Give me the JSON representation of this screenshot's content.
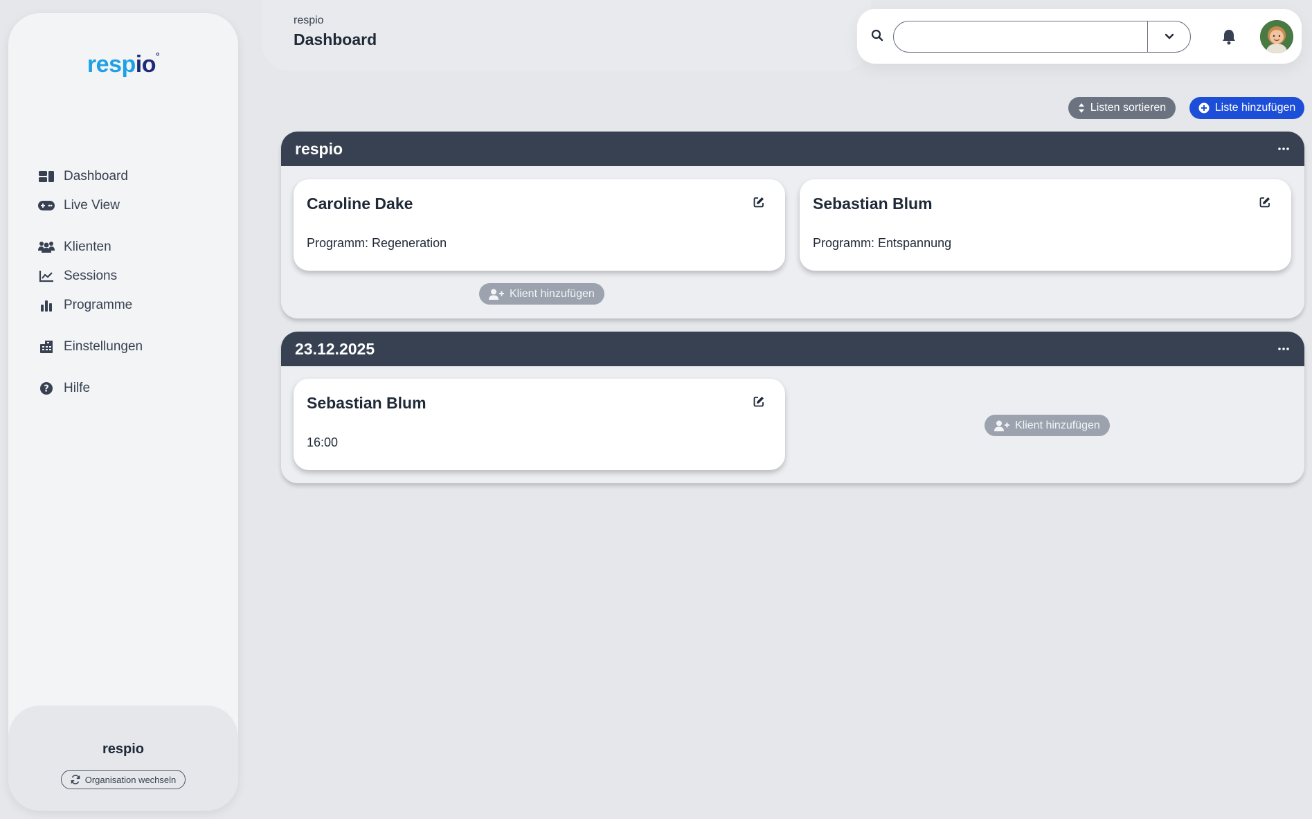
{
  "sidebar": {
    "logo_text_a": "resp",
    "logo_text_b": "io",
    "logo_mark": "°",
    "nav": [
      {
        "label": "Dashboard",
        "icon": "dashboard-icon"
      },
      {
        "label": "Live View",
        "icon": "gamepad-icon"
      },
      {
        "label": "Klienten",
        "icon": "users-icon"
      },
      {
        "label": "Sessions",
        "icon": "chart-line-icon"
      },
      {
        "label": "Programme",
        "icon": "chart-bar-icon"
      },
      {
        "label": "Einstellungen",
        "icon": "building-icon"
      },
      {
        "label": "Hilfe",
        "icon": "question-circle-icon"
      }
    ],
    "org_name": "respio",
    "org_switch_label": "Organisation wechseln"
  },
  "header": {
    "breadcrumb": "respio",
    "title": "Dashboard"
  },
  "topbar": {
    "search_value": "",
    "search_placeholder": ""
  },
  "actions": {
    "sort_label": "Listen sortieren",
    "add_list_label": "Liste hinzufügen"
  },
  "lists": [
    {
      "title": "respio",
      "cards": [
        {
          "name": "Caroline Dake",
          "subtitle": "Programm: Regeneration"
        },
        {
          "name": "Sebastian Blum",
          "subtitle": "Programm: Entspannung"
        }
      ],
      "add_client_label": "Klient hinzufügen"
    },
    {
      "title": "23.12.2025",
      "cards": [
        {
          "name": "Sebastian Blum",
          "subtitle": "16:00"
        }
      ],
      "add_client_label": "Klient hinzufügen"
    }
  ],
  "colors": {
    "accent": "#1d4ed8",
    "list_header": "#374151",
    "logo_blue": "#1ea0e6",
    "logo_dark": "#1e2a7a"
  }
}
